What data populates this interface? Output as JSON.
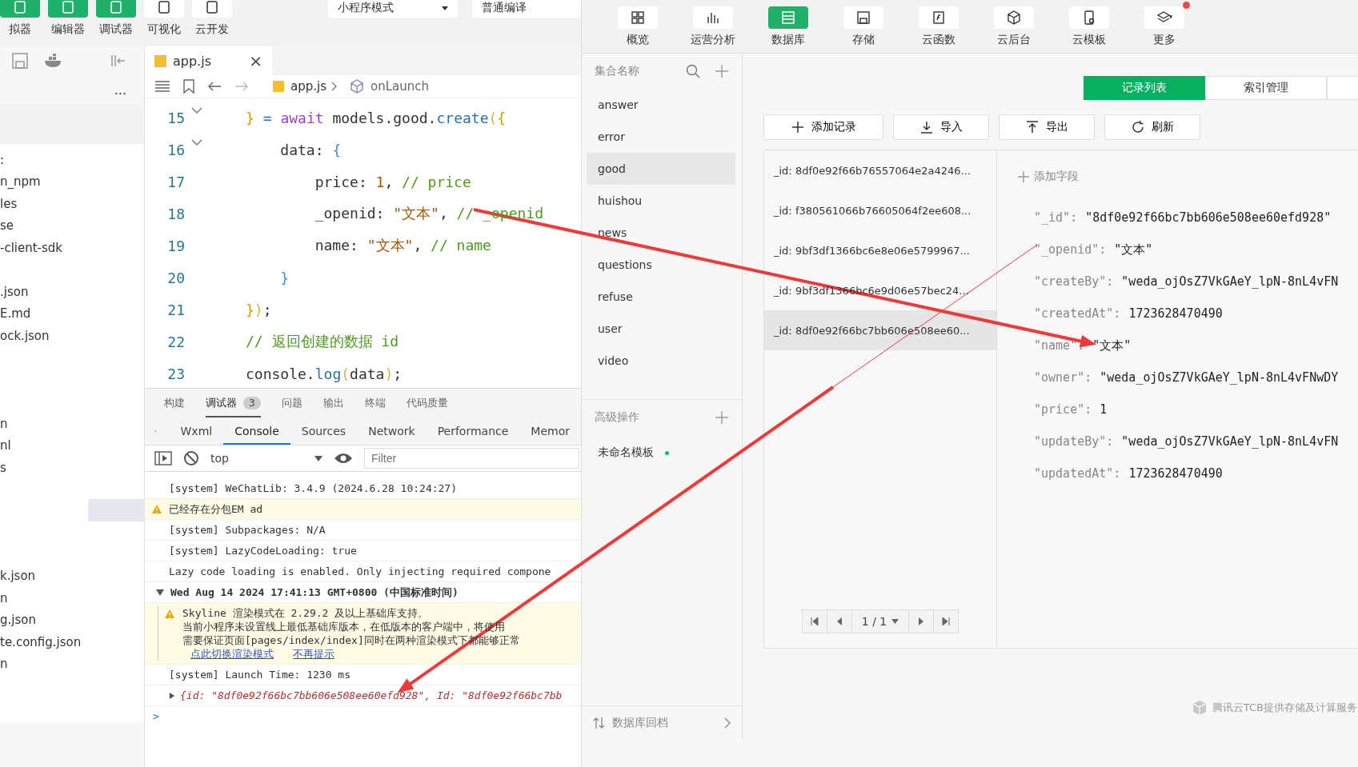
{
  "ide": {
    "toolbar": {
      "buttons": [
        {
          "label": "拟器",
          "active": true
        },
        {
          "label": "编辑器",
          "active": true
        },
        {
          "label": "调试器",
          "active": true
        },
        {
          "label": "可视化",
          "active": false
        },
        {
          "label": "云开发",
          "active": false
        }
      ],
      "mode_select": "小程序模式",
      "compile_select": "普通编译"
    },
    "file_tree": {
      "more": "...",
      "items": [
        {
          "name": ":",
          "selected": false
        },
        {
          "name": "n_npm",
          "selected": false
        },
        {
          "name": "les",
          "selected": false
        },
        {
          "name": "se",
          "selected": false
        },
        {
          "name": "-client-sdk",
          "selected": false
        },
        {
          "selected": false
        },
        {
          "name": ".json",
          "selected": false
        },
        {
          "name": "E.md",
          "selected": false
        },
        {
          "name": "ock.json",
          "selected": false
        },
        {
          "selected": false
        },
        {
          "selected": false
        },
        {
          "selected": false
        },
        {
          "name": "n",
          "selected": false
        },
        {
          "name": "nl",
          "selected": false
        },
        {
          "name": "s",
          "selected": false
        },
        {
          "selected": false
        },
        {
          "selected": true
        },
        {
          "selected": false
        },
        {
          "selected": false
        },
        {
          "name": "k.json",
          "selected": false
        },
        {
          "name": "n",
          "selected": false
        },
        {
          "name": "g.json",
          "selected": false
        },
        {
          "name": "te.config.json",
          "selected": false
        },
        {
          "name": "n",
          "selected": false
        }
      ]
    },
    "editor": {
      "tab": {
        "label": "app.js",
        "close": "×"
      },
      "breadcrumb": [
        "app.js",
        "onLaunch"
      ],
      "lines": [
        {
          "number": "15",
          "fold": true,
          "tokens": [
            {
              "text": "} ",
              "kind": "brace"
            },
            {
              "text": "= ",
              "kind": "op"
            },
            {
              "text": "await",
              "kind": "kw"
            },
            {
              "text": " models.good.",
              "kind": "plain"
            },
            {
              "text": "create",
              "kind": "fn"
            },
            {
              "text": "(",
              "kind": "paren"
            },
            {
              "text": "{",
              "kind": "brace"
            }
          ]
        },
        {
          "number": "16",
          "fold": true,
          "tokens": [
            {
              "text": "    data: ",
              "kind": "plain"
            },
            {
              "text": "{",
              "kind": "brace2"
            }
          ]
        },
        {
          "number": "17",
          "fold": false,
          "tokens": [
            {
              "text": "        price: ",
              "kind": "plain"
            },
            {
              "text": "1",
              "kind": "num"
            },
            {
              "text": ", ",
              "kind": "plain"
            },
            {
              "text": "// price",
              "kind": "comment"
            }
          ]
        },
        {
          "number": "18",
          "fold": false,
          "tokens": [
            {
              "text": "        _openid: ",
              "kind": "plain"
            },
            {
              "text": "\"文本\"",
              "kind": "str"
            },
            {
              "text": ", ",
              "kind": "plain"
            },
            {
              "text": "// _openid",
              "kind": "comment"
            }
          ]
        },
        {
          "number": "19",
          "fold": false,
          "tokens": [
            {
              "text": "        name: ",
              "kind": "plain"
            },
            {
              "text": "\"文本\"",
              "kind": "str"
            },
            {
              "text": ", ",
              "kind": "plain"
            },
            {
              "text": "// name",
              "kind": "comment"
            }
          ]
        },
        {
          "number": "20",
          "fold": false,
          "tokens": [
            {
              "text": "    }",
              "kind": "brace2"
            }
          ]
        },
        {
          "number": "21",
          "fold": false,
          "tokens": [
            {
              "text": "}",
              "kind": "brace"
            },
            {
              "text": ")",
              "kind": "paren"
            },
            {
              "text": ";",
              "kind": "plain"
            }
          ]
        },
        {
          "number": "22",
          "fold": false,
          "tokens": [
            {
              "text": "// 返回创建的数据 id",
              "kind": "comment"
            }
          ]
        },
        {
          "number": "23",
          "fold": false,
          "tokens": [
            {
              "text": "console.",
              "kind": "plain"
            },
            {
              "text": "log",
              "kind": "fn"
            },
            {
              "text": "(",
              "kind": "paren"
            },
            {
              "text": "data",
              "kind": "plain"
            },
            {
              "text": ")",
              "kind": "paren"
            },
            {
              "text": ";",
              "kind": "plain"
            }
          ]
        }
      ]
    },
    "panel": {
      "tabs": [
        {
          "label": "构建",
          "selected": false
        },
        {
          "label": "调试器",
          "badge": "3",
          "selected": true
        },
        {
          "label": "问题",
          "selected": false
        },
        {
          "label": "输出",
          "selected": false
        },
        {
          "label": "终端",
          "selected": false
        },
        {
          "label": "代码质量",
          "selected": false
        }
      ],
      "devtools_tabs": [
        {
          "label": "Wxml",
          "selected": false
        },
        {
          "label": "Console",
          "selected": true
        },
        {
          "label": "Sources",
          "selected": false
        },
        {
          "label": "Network",
          "selected": false
        },
        {
          "label": "Performance",
          "selected": false
        },
        {
          "label": "Memor",
          "selected": false
        }
      ],
      "context": "top",
      "filter": {
        "placeholder": "Filter"
      },
      "rows": [
        {
          "kind": "log",
          "text": "[system] WeChatLib: 3.4.9 (2024.6.28 10:24:27)"
        },
        {
          "kind": "warn",
          "text": "已经存在分包EM ad"
        },
        {
          "kind": "log",
          "text": "[system] Subpackages: N/A"
        },
        {
          "kind": "log",
          "text": "[system] LazyCodeLoading: true"
        },
        {
          "kind": "log",
          "text": "Lazy code loading is enabled. Only injecting required compone"
        },
        {
          "kind": "group",
          "text": "Wed Aug 14 2024 17:41:13 GMT+0800 (中国标准时间)",
          "expanded": true
        },
        {
          "kind": "warnblock",
          "lines": [
            "Skyline 渲染模式在 2.29.2 及以上基础库支持。",
            "当前小程序未设置线上最低基础库版本，在低版本的客户端中，将使用",
            "需要保证页面[pages/index/index]同时在两种渲染模式下都能够正常"
          ],
          "links": [
            "点此切换渲染模式",
            "不再提示"
          ]
        },
        {
          "kind": "log",
          "text": "[system] Launch Time: 1230 ms"
        },
        {
          "kind": "object",
          "text": "{id: \"8df0e92f66bc7bb606e508ee60efd928\", Id: \"8df0e92f66bc7bb",
          "expanded": false
        },
        {
          "kind": "prompt",
          "text": ">"
        }
      ]
    }
  },
  "cloud": {
    "toolbar": [
      {
        "label": "概览",
        "selected": false
      },
      {
        "label": "运营分析",
        "selected": false
      },
      {
        "label": "数据库",
        "selected": true
      },
      {
        "label": "存储",
        "selected": false
      },
      {
        "label": "云函数",
        "selected": false
      },
      {
        "label": "云后台",
        "selected": false
      },
      {
        "label": "云模板",
        "selected": false
      },
      {
        "label": "更多",
        "selected": false,
        "notification": true
      }
    ],
    "collections": {
      "header": "集合名称",
      "items": [
        {
          "name": "answer",
          "selected": false
        },
        {
          "name": "error",
          "selected": false
        },
        {
          "name": "good",
          "selected": true
        },
        {
          "name": "huishou",
          "selected": false
        },
        {
          "name": "news",
          "selected": false
        },
        {
          "name": "questions",
          "selected": false
        },
        {
          "name": "refuse",
          "selected": false
        },
        {
          "name": "user",
          "selected": false
        },
        {
          "name": "video",
          "selected": false
        }
      ],
      "advanced_header": "高级操作",
      "templates": [
        {
          "name": "未命名模板",
          "color": "#07c160"
        }
      ],
      "rollback": "数据库回档"
    },
    "tabs": [
      {
        "label": "记录列表",
        "selected": true
      },
      {
        "label": "索引管理",
        "selected": false
      }
    ],
    "actions": [
      "添加记录",
      "导入",
      "导出",
      "刷新"
    ],
    "records": [
      {
        "label": "_id: 8df0e92f66b76557064e2a4246...",
        "selected": false
      },
      {
        "label": "_id: f380561066b76605064f2ee608...",
        "selected": false
      },
      {
        "label": "_id: 9bf3df1366bc6e8e06e5799967...",
        "selected": false
      },
      {
        "label": "_id: 9bf3df1366bc6e9d06e57bec24...",
        "selected": false
      },
      {
        "label": "_id: 8df0e92f66bc7bb606e508ee60...",
        "selected": true
      }
    ],
    "pagination": "1 / 1",
    "add_field": "添加字段",
    "fields": [
      {
        "key": "\"_id\":",
        "value": "\"8df0e92f66bc7bb606e508ee60efd928\""
      },
      {
        "key": "\"_openid\":",
        "value": "\"文本\""
      },
      {
        "key": "\"createBy\":",
        "value": "\"weda_ojOsZ7VkGAeY_lpN-8nL4vFN"
      },
      {
        "key": "\"createdAt\":",
        "value": "1723628470490"
      },
      {
        "key": "\"name\":",
        "value": "\"文本\""
      },
      {
        "key": "\"owner\":",
        "value": "\"weda_ojOsZ7VkGAeY_lpN-8nL4vFNwDY"
      },
      {
        "key": "\"price\":",
        "value": "1"
      },
      {
        "key": "\"updateBy\":",
        "value": "\"weda_ojOsZ7VkGAeY_lpN-8nL4vFN"
      },
      {
        "key": "\"updatedAt\":",
        "value": "1723628470490"
      }
    ],
    "footer": "腾讯云TCB提供存储及计算服务"
  }
}
